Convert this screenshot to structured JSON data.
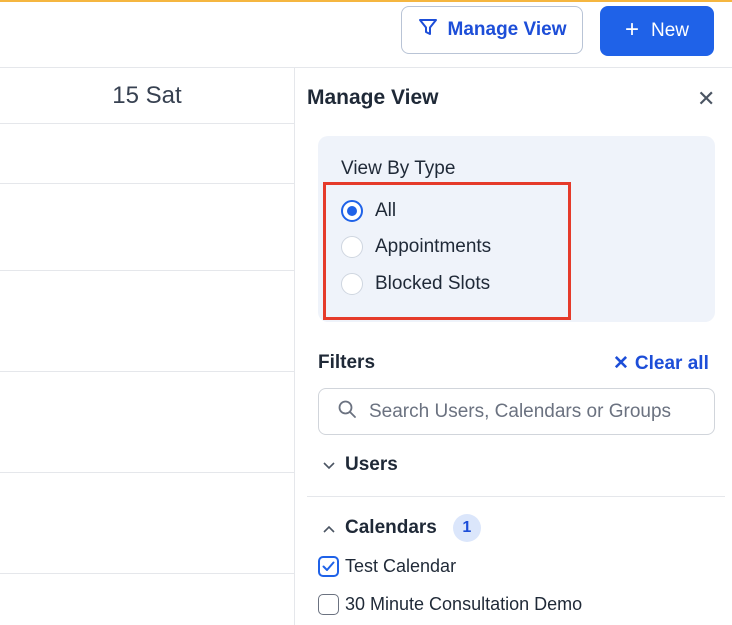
{
  "toolbar": {
    "manage_view_label": "Manage View",
    "new_label": "New",
    "accent_color": "#1f62e8"
  },
  "calendar": {
    "day_header": "15 Sat"
  },
  "panel": {
    "title": "Manage View",
    "view_by_type": {
      "label": "View By Type",
      "options": [
        {
          "label": "All",
          "selected": true
        },
        {
          "label": "Appointments",
          "selected": false
        },
        {
          "label": "Blocked Slots",
          "selected": false
        }
      ]
    },
    "filters": {
      "label": "Filters",
      "clear_all_label": "Clear all",
      "search_placeholder": "Search Users, Calendars or Groups"
    },
    "sections": {
      "users_label": "Users",
      "calendars_label": "Calendars",
      "calendars_count": "1"
    },
    "calendars": [
      {
        "label": "Test Calendar",
        "checked": true
      },
      {
        "label": "30 Minute Consultation Demo",
        "checked": false
      }
    ]
  }
}
